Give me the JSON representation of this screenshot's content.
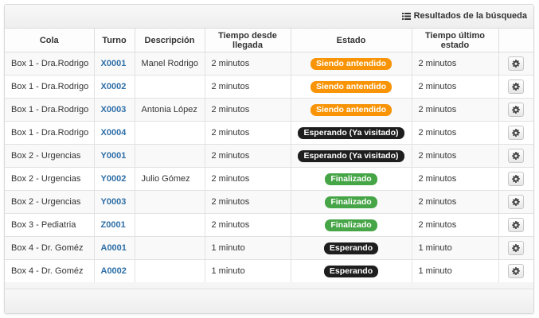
{
  "header": {
    "title": "Resultados de la búsqueda",
    "icon": "list-icon"
  },
  "table": {
    "columns": [
      "Cola",
      "Turno",
      "Descripción",
      "Tiempo desde llegada",
      "Estado",
      "Tiempo último estado",
      ""
    ],
    "rows": [
      {
        "cola": "Box 1 - Dra.Rodrigo",
        "turno": "X0001",
        "descripcion": "Manel Rodrigo",
        "tiempo_llegada": "2 minutos",
        "estado": "Siendo antendido",
        "estado_color": "#f89406",
        "tiempo_estado": "2 minutos"
      },
      {
        "cola": "Box 1 - Dra.Rodrigo",
        "turno": "X0002",
        "descripcion": "",
        "tiempo_llegada": "2 minutos",
        "estado": "Siendo antendido",
        "estado_color": "#f89406",
        "tiempo_estado": "2 minutos"
      },
      {
        "cola": "Box 1 - Dra.Rodrigo",
        "turno": "X0003",
        "descripcion": "Antonia López",
        "tiempo_llegada": "2 minutos",
        "estado": "Siendo antendido",
        "estado_color": "#f89406",
        "tiempo_estado": "2 minutos"
      },
      {
        "cola": "Box 1 - Dra.Rodrigo",
        "turno": "X0004",
        "descripcion": "",
        "tiempo_llegada": "2 minutos",
        "estado": "Esperando (Ya visitado)",
        "estado_color": "#1e1e1e",
        "tiempo_estado": "2 minutos"
      },
      {
        "cola": "Box 2 - Urgencias",
        "turno": "Y0001",
        "descripcion": "",
        "tiempo_llegada": "2 minutos",
        "estado": "Esperando (Ya visitado)",
        "estado_color": "#1e1e1e",
        "tiempo_estado": "2 minutos"
      },
      {
        "cola": "Box 2 - Urgencias",
        "turno": "Y0002",
        "descripcion": "Julio Gómez",
        "tiempo_llegada": "2 minutos",
        "estado": "Finalizado",
        "estado_color": "#46a546",
        "tiempo_estado": "2 minutos"
      },
      {
        "cola": "Box 2 - Urgencias",
        "turno": "Y0003",
        "descripcion": "",
        "tiempo_llegada": "2 minutos",
        "estado": "Finalizado",
        "estado_color": "#46a546",
        "tiempo_estado": "2 minutos"
      },
      {
        "cola": "Box 3 - Pediatria",
        "turno": "Z0001",
        "descripcion": "",
        "tiempo_llegada": "2 minutos",
        "estado": "Finalizado",
        "estado_color": "#46a546",
        "tiempo_estado": "2 minutos"
      },
      {
        "cola": "Box 4 - Dr. Goméz",
        "turno": "A0001",
        "descripcion": "",
        "tiempo_llegada": "1 minuto",
        "estado": "Esperando",
        "estado_color": "#1e1e1e",
        "tiempo_estado": "1 minuto"
      },
      {
        "cola": "Box 4 - Dr. Goméz",
        "turno": "A0002",
        "descripcion": "",
        "tiempo_llegada": "1 minuto",
        "estado": "Esperando",
        "estado_color": "#1e1e1e",
        "tiempo_estado": "1 minuto"
      }
    ],
    "row_action_icon": "gear-icon"
  }
}
